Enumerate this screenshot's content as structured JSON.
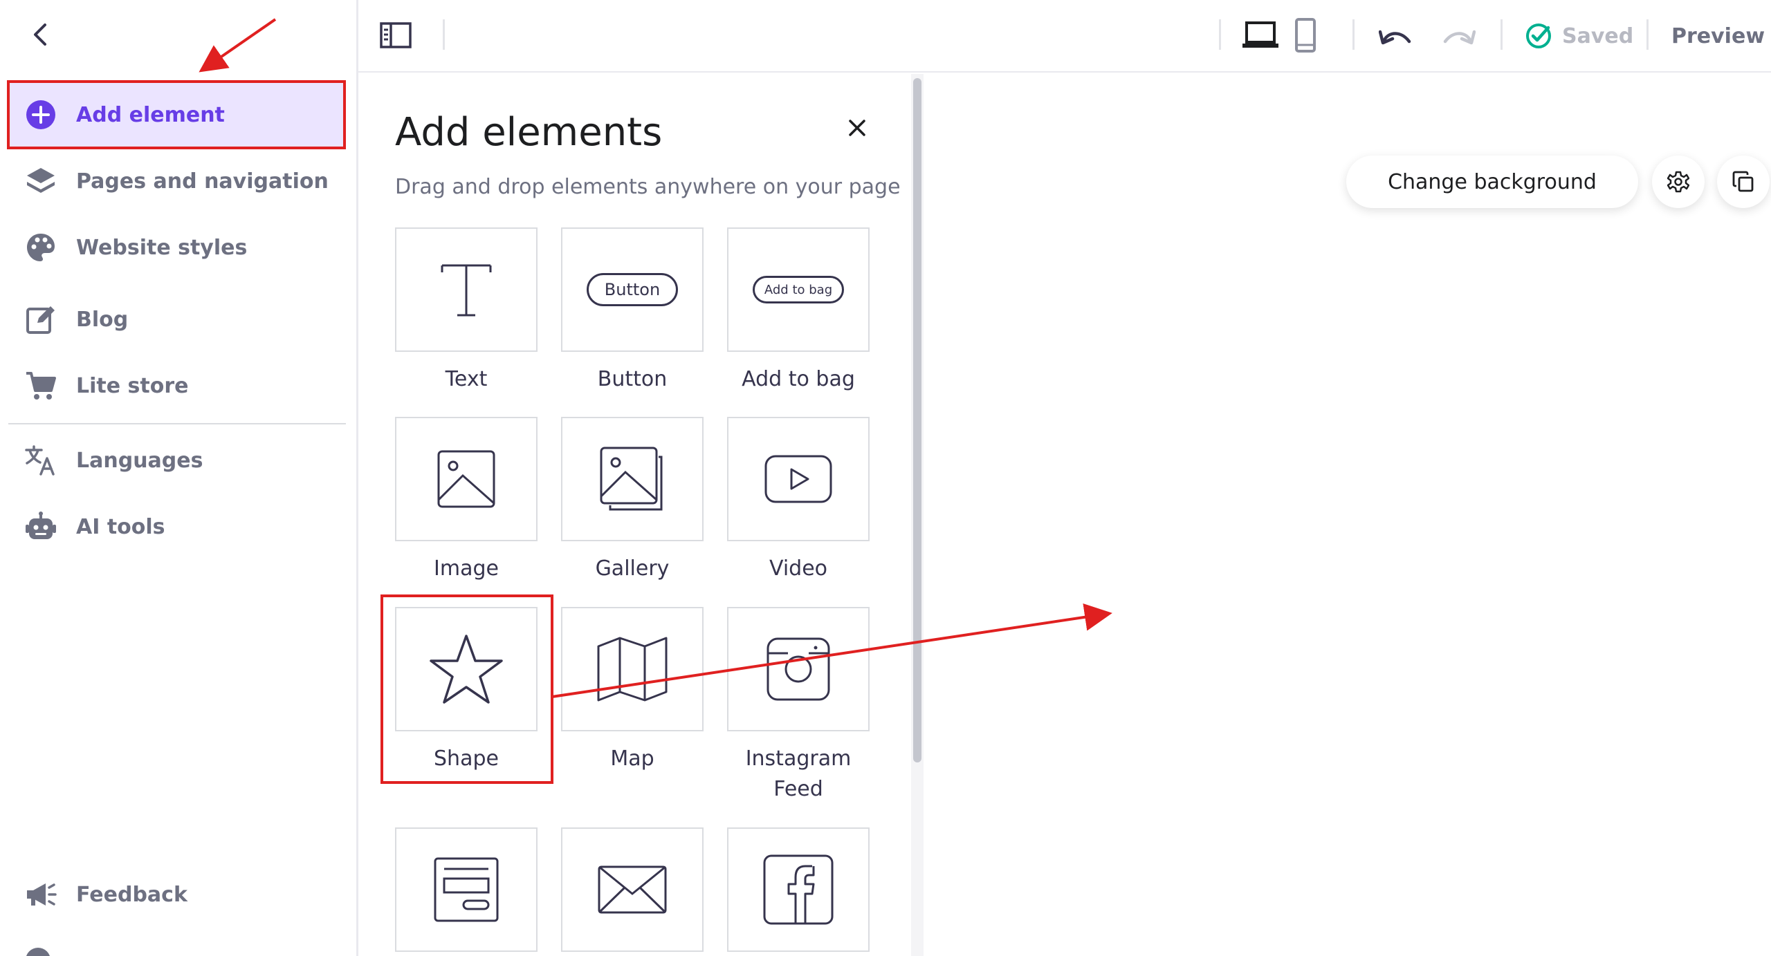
{
  "sidebar": {
    "back_icon": "chevron-left-icon",
    "items": [
      {
        "label": "Add element",
        "icon": "plus-circle-icon",
        "active": true
      },
      {
        "label": "Pages and navigation",
        "icon": "layers-icon"
      },
      {
        "label": "Website styles",
        "icon": "palette-icon"
      },
      {
        "label": "Blog",
        "icon": "edit-icon"
      },
      {
        "label": "Lite store",
        "icon": "cart-icon"
      },
      {
        "label": "Languages",
        "icon": "translate-icon"
      },
      {
        "label": "AI tools",
        "icon": "robot-icon"
      },
      {
        "label": "Feedback",
        "icon": "megaphone-icon"
      }
    ]
  },
  "toolbar": {
    "saved_label": "Saved",
    "preview_label": "Preview"
  },
  "panel": {
    "title": "Add elements",
    "subtitle": "Drag and drop elements anywhere on your page",
    "tiles": [
      {
        "label": "Text",
        "icon": "text-icon"
      },
      {
        "label": "Button",
        "icon": "button-icon",
        "preview_text": "Button"
      },
      {
        "label": "Add to bag",
        "icon": "add-to-bag-icon",
        "preview_text": "Add to bag"
      },
      {
        "label": "Image",
        "icon": "image-icon"
      },
      {
        "label": "Gallery",
        "icon": "gallery-icon"
      },
      {
        "label": "Video",
        "icon": "video-icon"
      },
      {
        "label": "Shape",
        "icon": "star-icon"
      },
      {
        "label": "Map",
        "icon": "map-icon"
      },
      {
        "label": "Instagram Feed",
        "icon": "instagram-icon"
      },
      {
        "label": "",
        "icon": "form-icon"
      },
      {
        "label": "",
        "icon": "envelope-icon"
      },
      {
        "label": "",
        "icon": "facebook-icon"
      }
    ]
  },
  "canvas": {
    "change_background_label": "Change background"
  },
  "colors": {
    "accent": "#673de6",
    "accent_bg": "#ebe4ff",
    "annotation_red": "#e02020",
    "saved_green": "#00b090"
  }
}
